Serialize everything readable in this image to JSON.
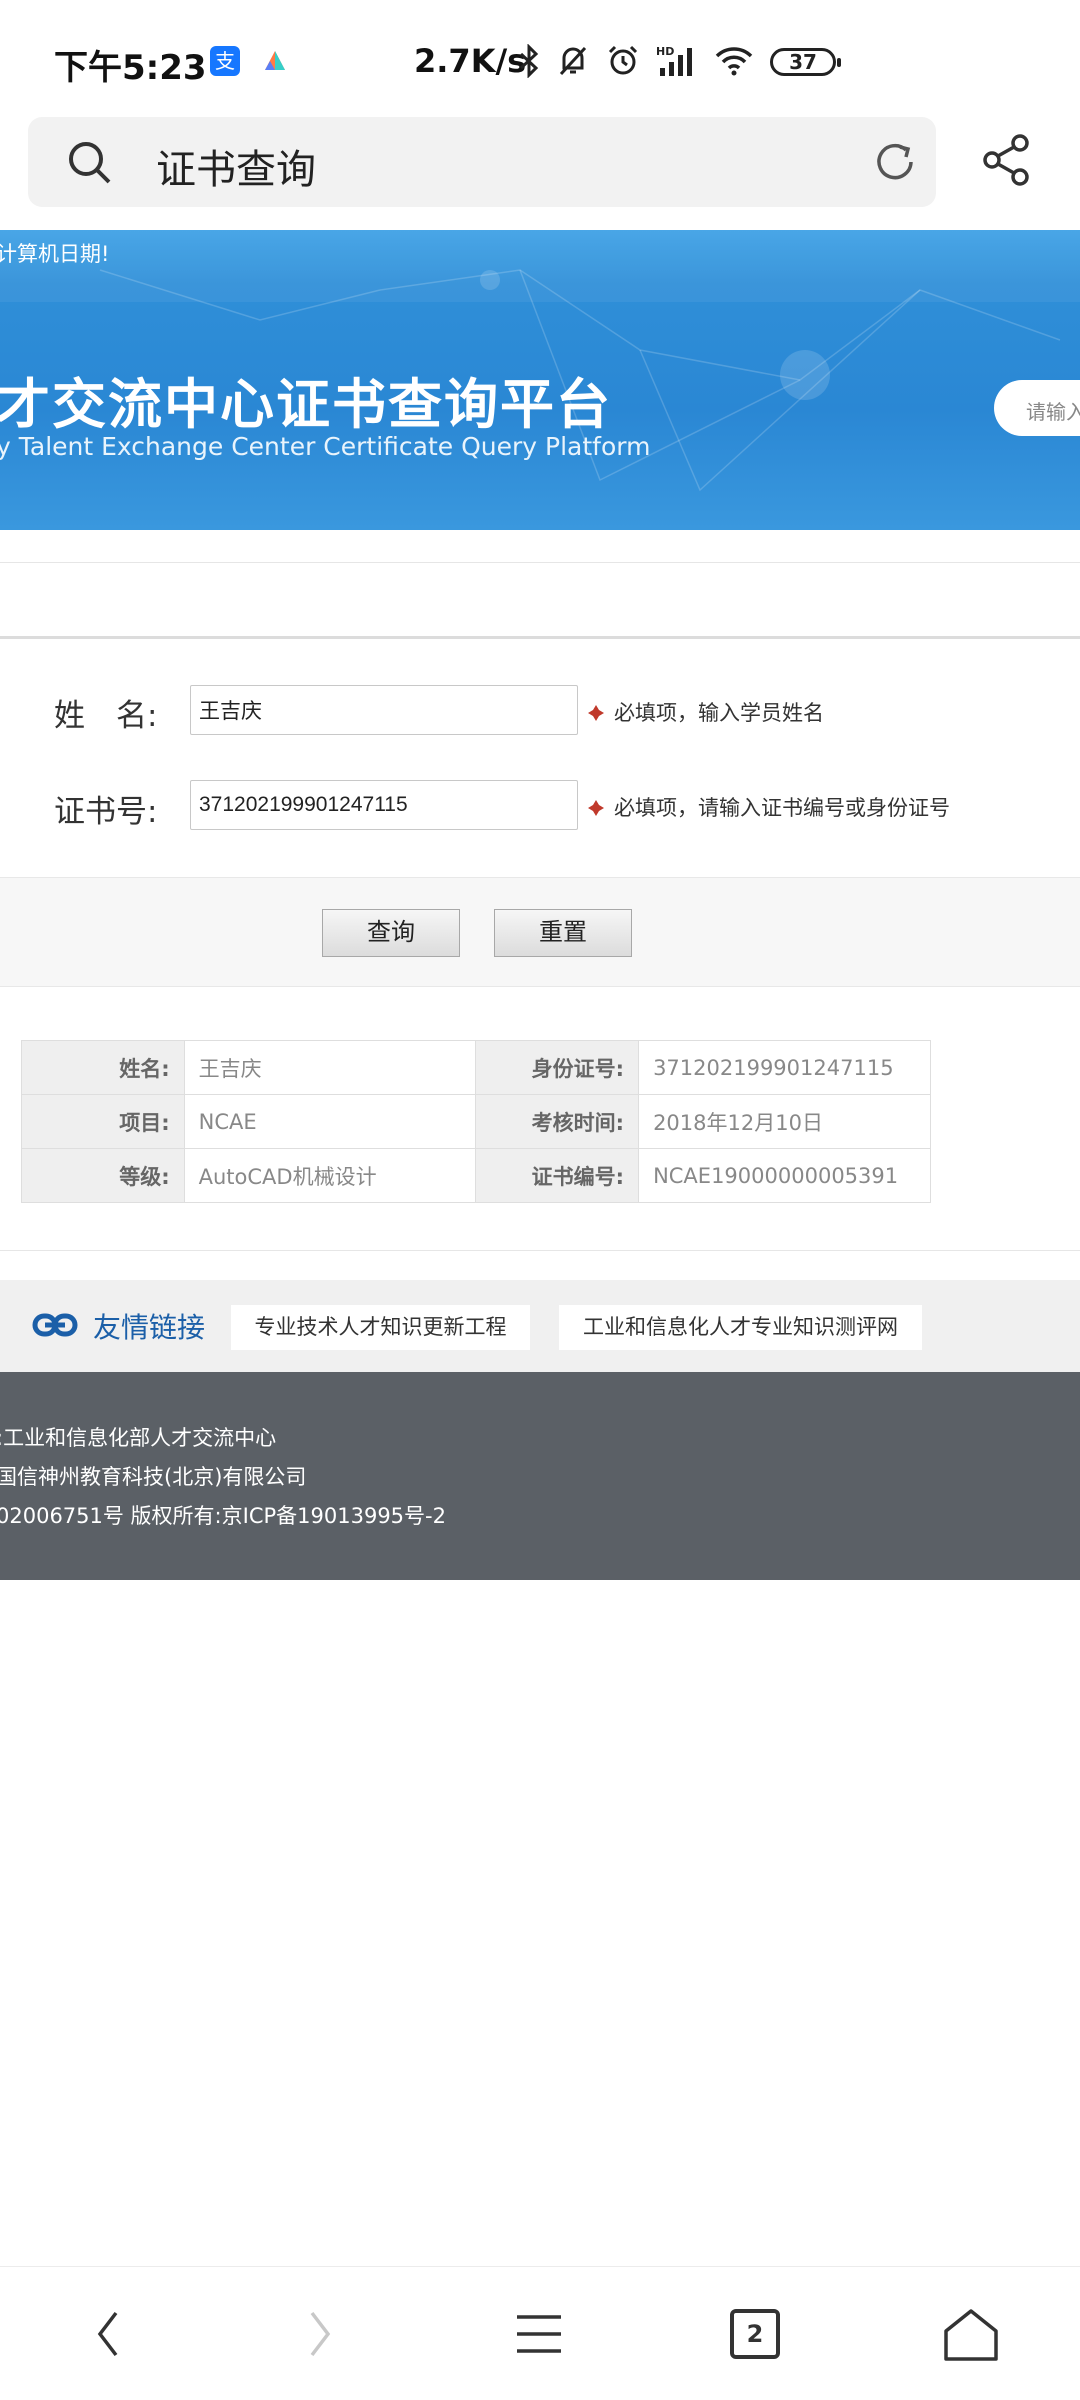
{
  "status_bar": {
    "time": "下午5:23",
    "network_speed": "2.7K/s",
    "battery": "37",
    "icons": [
      "alipay-icon",
      "maps-icon",
      "bluetooth-icon",
      "mute-icon",
      "alarm-icon",
      "signal-hd-icon",
      "wifi-icon",
      "battery-icon"
    ]
  },
  "browser": {
    "search_text": "证书查询",
    "tab_count": "2"
  },
  "banner": {
    "notice": "计算机日期!",
    "title": "才交流中心证书查询平台",
    "subtitle": "y Talent Exchange Center Certificate Query Platform",
    "search_placeholder": "请输入"
  },
  "form": {
    "name_label": "姓　名:",
    "name_value": "王吉庆",
    "name_hint": "必填项，输入学员姓名",
    "cert_label": "证书号:",
    "cert_value": "371202199901247115",
    "cert_hint": "必填项，请输入证书编号或身份证号",
    "query_button": "查询",
    "reset_button": "重置"
  },
  "result": {
    "rows": [
      {
        "k1": "姓名:",
        "v1": "王吉庆",
        "k2": "身份证号:",
        "v2": "371202199901247115"
      },
      {
        "k1": "项目:",
        "v1": "NCAE",
        "k2": "考核时间:",
        "v2": "2018年12月10日"
      },
      {
        "k1": "等级:",
        "v1": "AutoCAD机械设计",
        "k2": "证书编号:",
        "v2": "NCAE19000000005391"
      }
    ]
  },
  "links": {
    "title": "友情链接",
    "items": [
      "专业技术人才知识更新工程",
      "工业和信息化人才专业知识测评网"
    ]
  },
  "footer": {
    "line1": ":工业和信息化部人才交流中心",
    "line2": "国信神州教育科技(北京)有限公司",
    "line3": "02006751号 版权所有:京ICP备19013995号-2"
  },
  "colors": {
    "banner_blue": "#2f8fd8",
    "link_blue": "#1b5fa8",
    "footer_gray": "#5b6066",
    "required_red": "#c0392b"
  }
}
